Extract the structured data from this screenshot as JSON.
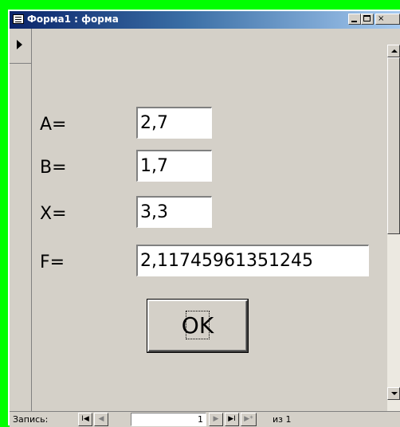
{
  "window": {
    "title": "Форма1 : форма",
    "close_glyph": "×"
  },
  "form": {
    "fields": [
      {
        "label": "A=",
        "value": "2,7"
      },
      {
        "label": "B=",
        "value": "1,7"
      },
      {
        "label": "X=",
        "value": "3,3"
      },
      {
        "label": "F=",
        "value": "2,11745961351245"
      }
    ],
    "ok_button": "OK"
  },
  "navigation": {
    "label": "Запись:",
    "current_record": "1",
    "of_text": "из",
    "total_records": "1",
    "first_glyph": "I◀",
    "prev_glyph": "◀",
    "next_glyph": "▶",
    "last_glyph": "▶I",
    "new_glyph": "▶*"
  },
  "colors": {
    "background": "#00ff00",
    "window_face": "#d4d0c8",
    "titlebar_start": "#0a246a",
    "titlebar_end": "#a6caf0"
  }
}
